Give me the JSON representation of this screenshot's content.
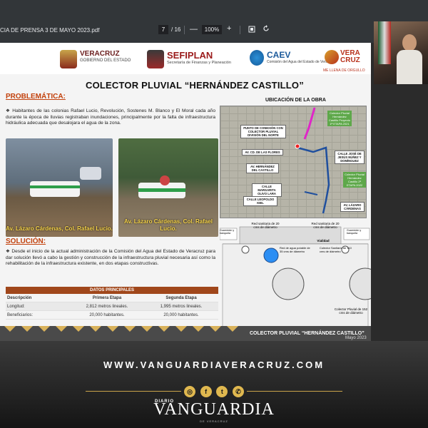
{
  "viewer": {
    "filename": "CIA DE PRENSA 3 DE MAYO 2023.pdf",
    "page_current": "7",
    "page_total": "/ 16",
    "zoom": "100%",
    "zoom_minus": "—",
    "zoom_plus": "+",
    "fit_icon": "fit-page-icon",
    "rotate_icon": "rotate-icon"
  },
  "slide": {
    "logos": {
      "veracruz_name": "VERACRUZ",
      "veracruz_sub": "GOBIERNO DEL ESTADO",
      "sefiplan_name": "SEFIPLAN",
      "sefiplan_sub": "Secretaría de Finanzas y Planeación",
      "caev_name": "CAEV",
      "caev_sub": "Comisión del Agua del Estado de Veracruz",
      "veracruz2_name": "VERA CRUZ",
      "veracruz2_sub": "ME LLENA DE ORGULLO"
    },
    "title": "COLECTOR PLUVIAL “HERNÁNDEZ CASTILLO”",
    "problem_heading": "PROBLEMÁTICA:",
    "problem_text": "Habitantes de las colonias Rafael Lucio, Revolución, Sostenes M. Blanco y El Moral cada año durante la época de lluvias registraban inundaciones, principalmente por la falta de infraestructura hidráulica adecuada que desalojara el agua de la zona.",
    "photo1_caption": "Av. Lázaro Cárdenas, Col. Rafael Lucio.",
    "photo2_caption": "Av. Lázaro Cárdenas, Col. Rafael Lucio.",
    "solution_heading": "SOLUCIÓN:",
    "solution_text": "Desde el inicio de la actual administración de la Comisión del Agua del Estado de Veracruz para dar solución llevó a cabo la gestión y construcción de la infraestructura pluvial necesaria así como la rehabilitación de la infraestructura existente, en dos etapas constructivas.",
    "table": {
      "title": "DATOS PRINCIPALES",
      "headers": [
        "Descripción",
        "Primera Etapa",
        "Segunda Etapa"
      ],
      "rows": [
        [
          "Longitud:",
          "2,812 metros lineales.",
          "1,995 metros lineales."
        ],
        [
          "Beneficiarios:",
          "20,000 habitantes.",
          "20,000 habitantes."
        ]
      ]
    },
    "map_heading": "UBICACIÓN DE LA OBRA",
    "map_labels": {
      "punto": "PUNTO DE CONEXIÓN CON COLECTOR PLUVIAL DIVISIÓN DEL NORTE",
      "flores": "AV. CD. DE LAS FLORES",
      "hernandez": "AV. HERNÁNDEZ DEL CASTILLO",
      "margarita": "CALLE MARGARITA OLIVO LARA",
      "leopoldo": "CALLE LEOPOLDO KIEL",
      "jose": "CALLE JOSÉ DE JESÚS NÚÑEZ Y DOMÍNGUEZ",
      "lazaro": "AV. LÁZARO CÁRDENAS",
      "etapa1": "Colector Pluvial Hernández Castillo Proyecto 1ª ETAPA 2021",
      "etapa2": "Colector Pluvial Hernández Castillo 2ª ETAPA 2022"
    },
    "diagram_labels": {
      "left_top": "Guarnición y banqueta",
      "right_top": "Guarnición y banqueta",
      "red1": "Red sanitaria de 20 cms de diámetro",
      "red2": "Red sanitaria de 20 cms de diámetro",
      "vialidad": "Vialidad",
      "agua": "Red de agua potable de 35 cms de diámetro",
      "colector_san": "Colector Sanitario de 110 cms de diámetro",
      "colector_pluvial": "Colector Pluvial de 152 cms de diámetro"
    },
    "footer_text": "COLECTOR PLUVIAL “HERNÁNDEZ CASTILLO”",
    "footer_date": "Mayo 2023"
  },
  "banner": {
    "url": "WWW.VANGUARDIAVERACRUZ.COM",
    "diario": "DIARIO",
    "brand": "VANGUARDIA",
    "brand_sub": "DE VERACRUZ",
    "social_icons": [
      "instagram-icon",
      "facebook-icon",
      "twitter-icon",
      "whatsapp-icon"
    ]
  },
  "colors": {
    "heading_orange": "#c2410c",
    "table_header": "#a0471b",
    "gold": "#c9a34a",
    "route_blue": "#1f4f9e",
    "route_magenta": "#e026c8"
  }
}
